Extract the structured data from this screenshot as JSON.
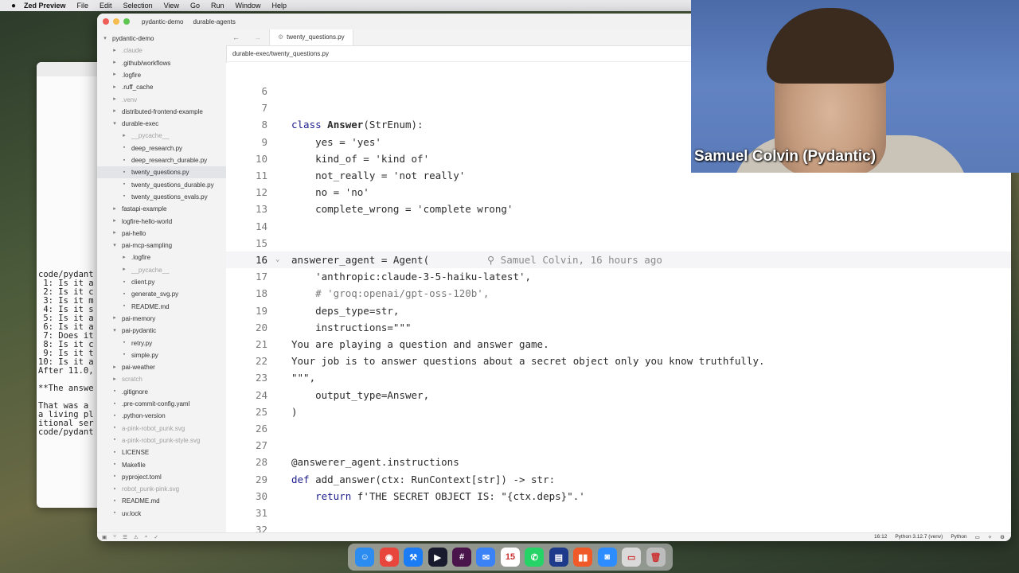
{
  "menubar": {
    "app_name": "Zed Preview",
    "items": [
      "File",
      "Edit",
      "Selection",
      "View",
      "Go",
      "Run",
      "Window",
      "Help"
    ]
  },
  "terminal": {
    "lines": [
      "code/pydant",
      " 1: Is it a",
      " 2: Is it c",
      " 3: Is it m",
      " 4: Is it s",
      " 5: Is it a",
      " 6: Is it a",
      " 7: Does it",
      " 8: Is it c",
      " 9: Is it t",
      "10: Is it a",
      "After 11.0,",
      "",
      "**The answe",
      "",
      "That was a ",
      "a living pl",
      "itional ser",
      "code/pydant"
    ]
  },
  "titlebar": {
    "project": "pydantic-demo",
    "branch": "durable-agents"
  },
  "sidebar": {
    "items": [
      {
        "label": "pydantic-demo",
        "depth": 0,
        "kind": "folder-open",
        "dim": false
      },
      {
        "label": ".claude",
        "depth": 1,
        "kind": "folder",
        "dim": true
      },
      {
        "label": ".github/workflows",
        "depth": 1,
        "kind": "folder",
        "dim": false
      },
      {
        "label": ".logfire",
        "depth": 1,
        "kind": "folder",
        "dim": false
      },
      {
        "label": ".ruff_cache",
        "depth": 1,
        "kind": "folder",
        "dim": false
      },
      {
        "label": ".venv",
        "depth": 1,
        "kind": "folder",
        "dim": true
      },
      {
        "label": "distributed-frontend-example",
        "depth": 1,
        "kind": "folder",
        "dim": false
      },
      {
        "label": "durable-exec",
        "depth": 1,
        "kind": "folder-open",
        "dim": false
      },
      {
        "label": "__pycache__",
        "depth": 2,
        "kind": "folder",
        "dim": true
      },
      {
        "label": "deep_research.py",
        "depth": 2,
        "kind": "file",
        "dim": false
      },
      {
        "label": "deep_research_durable.py",
        "depth": 2,
        "kind": "file",
        "dim": false
      },
      {
        "label": "twenty_questions.py",
        "depth": 2,
        "kind": "file",
        "dim": false,
        "active": true
      },
      {
        "label": "twenty_questions_durable.py",
        "depth": 2,
        "kind": "file",
        "dim": false
      },
      {
        "label": "twenty_questions_evals.py",
        "depth": 2,
        "kind": "file",
        "dim": false
      },
      {
        "label": "fastapi-example",
        "depth": 1,
        "kind": "folder",
        "dim": false
      },
      {
        "label": "logfire-hello-world",
        "depth": 1,
        "kind": "folder",
        "dim": false
      },
      {
        "label": "pai-hello",
        "depth": 1,
        "kind": "folder",
        "dim": false
      },
      {
        "label": "pai-mcp-sampling",
        "depth": 1,
        "kind": "folder-open",
        "dim": false
      },
      {
        "label": ".logfire",
        "depth": 2,
        "kind": "folder",
        "dim": false
      },
      {
        "label": "__pycache__",
        "depth": 2,
        "kind": "folder",
        "dim": true
      },
      {
        "label": "client.py",
        "depth": 2,
        "kind": "file",
        "dim": false
      },
      {
        "label": "generate_svg.py",
        "depth": 2,
        "kind": "file",
        "dim": false
      },
      {
        "label": "README.md",
        "depth": 2,
        "kind": "file",
        "dim": false
      },
      {
        "label": "pai-memory",
        "depth": 1,
        "kind": "folder",
        "dim": false
      },
      {
        "label": "pai-pydantic",
        "depth": 1,
        "kind": "folder-open",
        "dim": false
      },
      {
        "label": "retry.py",
        "depth": 2,
        "kind": "file",
        "dim": false
      },
      {
        "label": "simple.py",
        "depth": 2,
        "kind": "file",
        "dim": false
      },
      {
        "label": "pai-weather",
        "depth": 1,
        "kind": "folder",
        "dim": false
      },
      {
        "label": "scratch",
        "depth": 1,
        "kind": "folder",
        "dim": true
      },
      {
        "label": ".gitignore",
        "depth": 1,
        "kind": "file",
        "dim": false
      },
      {
        "label": ".pre-commit-config.yaml",
        "depth": 1,
        "kind": "file",
        "dim": false
      },
      {
        "label": ".python-version",
        "depth": 1,
        "kind": "file",
        "dim": false
      },
      {
        "label": "a-pink-robot_punk.svg",
        "depth": 1,
        "kind": "file",
        "dim": true
      },
      {
        "label": "a-pink-robot_punk-style.svg",
        "depth": 1,
        "kind": "file",
        "dim": true
      },
      {
        "label": "LICENSE",
        "depth": 1,
        "kind": "file",
        "dim": false
      },
      {
        "label": "Makefile",
        "depth": 1,
        "kind": "file",
        "dim": false
      },
      {
        "label": "pyproject.toml",
        "depth": 1,
        "kind": "file",
        "dim": false
      },
      {
        "label": "robot_punk-pink.svg",
        "depth": 1,
        "kind": "file",
        "dim": true
      },
      {
        "label": "README.md",
        "depth": 1,
        "kind": "file",
        "dim": false
      },
      {
        "label": "uv.lock",
        "depth": 1,
        "kind": "file",
        "dim": false
      }
    ]
  },
  "tab": {
    "label": "twenty_questions.py"
  },
  "breadcrumb": "durable-exec/twenty_questions.py",
  "editor": {
    "current_line": 16,
    "lines": [
      {
        "n": 6,
        "t": ""
      },
      {
        "n": 7,
        "t": ""
      },
      {
        "n": 8,
        "t": "class Answer(StrEnum):"
      },
      {
        "n": 9,
        "t": "    yes = 'yes'"
      },
      {
        "n": 10,
        "t": "    kind_of = 'kind of'"
      },
      {
        "n": 11,
        "t": "    not_really = 'not really'"
      },
      {
        "n": 12,
        "t": "    no = 'no'"
      },
      {
        "n": 13,
        "t": "    complete_wrong = 'complete wrong'"
      },
      {
        "n": 14,
        "t": ""
      },
      {
        "n": 15,
        "t": ""
      },
      {
        "n": 16,
        "t": "answerer_agent = Agent("
      },
      {
        "n": 17,
        "t": "    'anthropic:claude-3-5-haiku-latest',"
      },
      {
        "n": 18,
        "t": "    # 'groq:openai/gpt-oss-120b',"
      },
      {
        "n": 19,
        "t": "    deps_type=str,"
      },
      {
        "n": 20,
        "t": "    instructions=\"\"\""
      },
      {
        "n": 21,
        "t": "You are playing a question and answer game."
      },
      {
        "n": 22,
        "t": "Your job is to answer questions about a secret object only you know truthfully."
      },
      {
        "n": 23,
        "t": "\"\"\","
      },
      {
        "n": 24,
        "t": "    output_type=Answer,"
      },
      {
        "n": 25,
        "t": ")"
      },
      {
        "n": 26,
        "t": ""
      },
      {
        "n": 27,
        "t": ""
      },
      {
        "n": 28,
        "t": "@answerer_agent.instructions"
      },
      {
        "n": 29,
        "t": "def add_answer(ctx: RunContext[str]) -> str:"
      },
      {
        "n": 30,
        "t": "    return f'THE SECRET OBJECT IS: \"{ctx.deps}\".'"
      },
      {
        "n": 31,
        "t": ""
      },
      {
        "n": 32,
        "t": ""
      }
    ],
    "blame": "Samuel Colvin, 16 hours ago"
  },
  "statusbar": {
    "position": "16:12",
    "interpreter": "Python 3.12.7 (venv)",
    "language": "Python"
  },
  "video": {
    "participant_name": "Samuel Colvin (Pydantic)"
  },
  "dock": {
    "apps": [
      {
        "name": "finder",
        "glyph": "☺",
        "color": "#2d8cf0"
      },
      {
        "name": "chrome",
        "glyph": "◉",
        "color": "#e8453c"
      },
      {
        "name": "xcode",
        "glyph": "⚒",
        "color": "#1c7cf4"
      },
      {
        "name": "terminal-app",
        "glyph": "▶",
        "color": "#1a1a2e"
      },
      {
        "name": "slack",
        "glyph": "#",
        "color": "#4a154b"
      },
      {
        "name": "mail",
        "glyph": "✉",
        "color": "#3b82f6"
      },
      {
        "name": "calendar",
        "glyph": "15",
        "color": "#ffffff"
      },
      {
        "name": "whatsapp",
        "glyph": "✆",
        "color": "#25d366"
      },
      {
        "name": "notes",
        "glyph": "▤",
        "color": "#1e3a8a"
      },
      {
        "name": "pycharm",
        "glyph": "▮▮",
        "color": "#f05a28"
      },
      {
        "name": "zoom",
        "glyph": "◙",
        "color": "#2d8cff"
      },
      {
        "name": "preview",
        "glyph": "▭",
        "color": "#d9d9d9"
      },
      {
        "name": "trash",
        "glyph": "🗑",
        "color": "#bdbdbd"
      }
    ]
  }
}
